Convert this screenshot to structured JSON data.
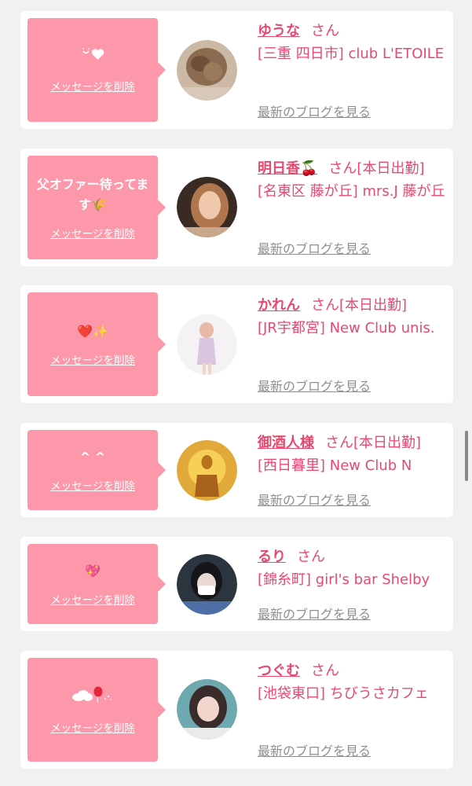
{
  "messages": [
    {
      "message": "",
      "icon": "smile-heart-icon",
      "name": "ゆうな",
      "suffix": "さん",
      "shop": "[三重 四日市] club L'ETOILE",
      "delete_label": "メッセージを削除",
      "blog_label": "最新のブログを見る"
    },
    {
      "message": "父オファー待ってます🌾",
      "icon": "",
      "name": "明日香🍒",
      "suffix": "さん[本日出勤]",
      "shop": "[名東区 藤が丘] mrs.J 藤が丘",
      "delete_label": "メッセージを削除",
      "blog_label": "最新のブログを見る"
    },
    {
      "message": "❤️✨",
      "icon": "",
      "name": "かれん",
      "suffix": "さん[本日出勤]",
      "shop": "[JR宇都宮] New Club unis.",
      "delete_label": "メッセージを削除",
      "blog_label": "最新のブログを見る"
    },
    {
      "message": "^ ^",
      "icon": "",
      "name": "御酒人様",
      "suffix": "さん[本日出勤]",
      "shop": "[西日暮里] New Club N",
      "delete_label": "メッセージを削除",
      "blog_label": "最新のブログを見る"
    },
    {
      "message": "💖",
      "icon": "",
      "name": "るり",
      "suffix": "さん",
      "shop": "[錦糸町] girl's bar Shelby",
      "delete_label": "メッセージを削除",
      "blog_label": "最新のブログを見る"
    },
    {
      "message": "",
      "icon": "cloud-balloon-icon",
      "name": "つぐむ",
      "suffix": "さん",
      "shop": "[池袋東口] ちびうさカフェ",
      "delete_label": "メッセージを削除",
      "blog_label": "最新のブログを見る"
    }
  ],
  "colors": {
    "accent": "#e8496f",
    "bubble": "#fc98a9",
    "page_bg": "#f1f1f1",
    "card_bg": "#ffffff",
    "link_gray": "#8f8f8f"
  }
}
